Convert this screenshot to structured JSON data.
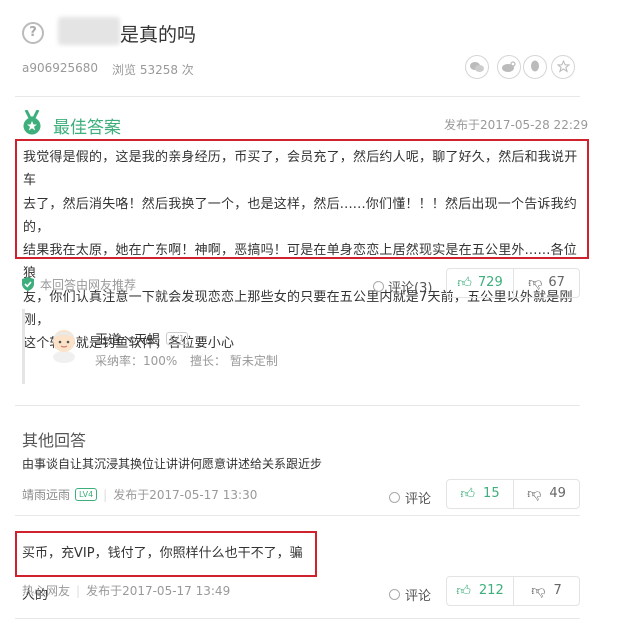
{
  "question": {
    "title_visible": "是真的吗",
    "user": "a906925680",
    "views": "浏览 53258 次"
  },
  "share_icons": [
    "wechat-icon",
    "weibo-icon",
    "qq-icon",
    "qzone-star-icon"
  ],
  "best_answer": {
    "label": "最佳答案",
    "posted": "发布于2017-05-28 22:29",
    "lines": [
      "我觉得是假的，这是我的亲身经历，币买了，会员充了，然后约人呢，聊了好久，然后和我说开车",
      "去了，然后消失咯！然后我换了一个，也是这样，然后......你们懂！！！然后出现一个告诉我约的，",
      "结果我在太原，她在广东啊！神啊，恶搞吗！可是在单身恋恋上居然现实是在五公里外......各位狼",
      "友，你们认真注意一下就会发现恋恋上那些女的只要在五公里内就是7天前，五公里以外就是刚刚，",
      "这个软件就是钓鱼软件，各位要小心"
    ],
    "recommended": "本回答由网友推荐",
    "comment_label": "评论(3)",
    "up": "729",
    "down": "67"
  },
  "answerer": {
    "name": "王道丶天蝎",
    "level": "LV1",
    "adopt_rate": "采纳率：100%",
    "specialty": "擅长：  暂未定制"
  },
  "other": {
    "heading": "其他回答",
    "items": [
      {
        "text": "由事谈自让其沉浸其换位让讲讲何愿意讲述给关系跟近步",
        "user": "靖雨远雨",
        "level": "LV4",
        "posted": "发布于2017-05-17 13:30",
        "comment_label": "评论",
        "up": "15",
        "down": "49"
      },
      {
        "text": "买币，充VIP，钱付了，你照样什么也干不了，骗人的",
        "user": "热心网友",
        "posted": "发布于2017-05-17 13:49",
        "comment_label": "评论",
        "up": "212",
        "down": "7"
      }
    ]
  },
  "colors": {
    "green": "#3eaf7c",
    "highlight_red": "#d0212e"
  }
}
